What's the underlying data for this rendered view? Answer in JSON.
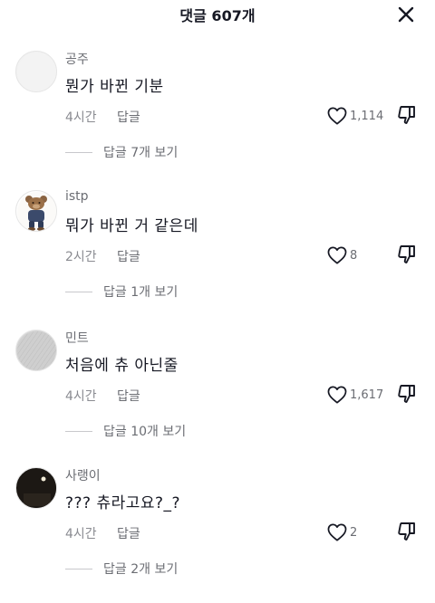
{
  "header": {
    "title": "댓글 607개"
  },
  "comments": [
    {
      "username": "공주",
      "text": "뭔가 바뀐 기분",
      "time": "4시간",
      "reply_label": "답글",
      "likes": "1,114",
      "replies_label": "답글 7개 보기",
      "avatar_icon": "blank-avatar"
    },
    {
      "username": "istp",
      "text": "뭐가 바뀐 거 같은데",
      "time": "2시간",
      "reply_label": "답글",
      "likes": "8",
      "replies_label": "답글 1개 보기",
      "avatar_icon": "teddy-bear-avatar"
    },
    {
      "username": "민트",
      "text": "처음에 츄 아닌줄",
      "time": "4시간",
      "reply_label": "답글",
      "likes": "1,617",
      "replies_label": "답글 10개 보기",
      "avatar_icon": "gray-texture-avatar"
    },
    {
      "username": "사랭이",
      "text": "??? 츄라고요?_?",
      "time": "4시간",
      "reply_label": "답글",
      "likes": "2",
      "replies_label": "답글 2개 보기",
      "avatar_icon": "dark-night-avatar"
    }
  ],
  "icons": {
    "close": "close-icon",
    "like": "heart-outline-icon",
    "dislike": "thumbs-down-icon"
  },
  "colors": {
    "primary_text": "#161823",
    "secondary_text": "#6b6d73",
    "muted_text": "#8a8b91"
  }
}
